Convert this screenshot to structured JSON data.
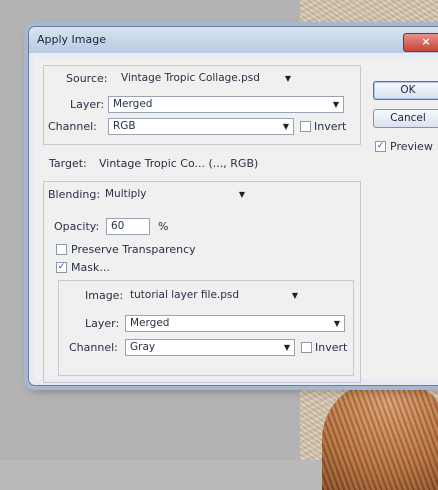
{
  "dialog": {
    "title": "Apply Image",
    "close_glyph": "×"
  },
  "source": {
    "label": "Source:",
    "value": "Vintage Tropic Collage.psd",
    "layer_label": "Layer:",
    "layer_value": "Merged",
    "channel_label": "Channel:",
    "channel_value": "RGB",
    "invert_label": "Invert",
    "invert_checked": false
  },
  "target": {
    "label": "Target:",
    "value": "Vintage Tropic Co... (..., RGB)"
  },
  "blending": {
    "label": "Blending:",
    "value": "Multiply",
    "opacity_label": "Opacity:",
    "opacity_value": "60",
    "opacity_unit": "%",
    "preserve_label": "Preserve Transparency",
    "preserve_checked": false,
    "mask_label": "Mask...",
    "mask_checked": true
  },
  "mask": {
    "image_label": "Image:",
    "image_value": "tutorial layer file.psd",
    "layer_label": "Layer:",
    "layer_value": "Merged",
    "channel_label": "Channel:",
    "channel_value": "Gray",
    "invert_label": "Invert",
    "invert_checked": false
  },
  "buttons": {
    "ok": "OK",
    "cancel": "Cancel",
    "preview_label": "Preview",
    "preview_checked": true
  },
  "glyphs": {
    "check": "✓",
    "dropdown": "▼"
  },
  "icons": [
    "close-icon",
    "chevron-down-icon",
    "checkmark-icon"
  ]
}
